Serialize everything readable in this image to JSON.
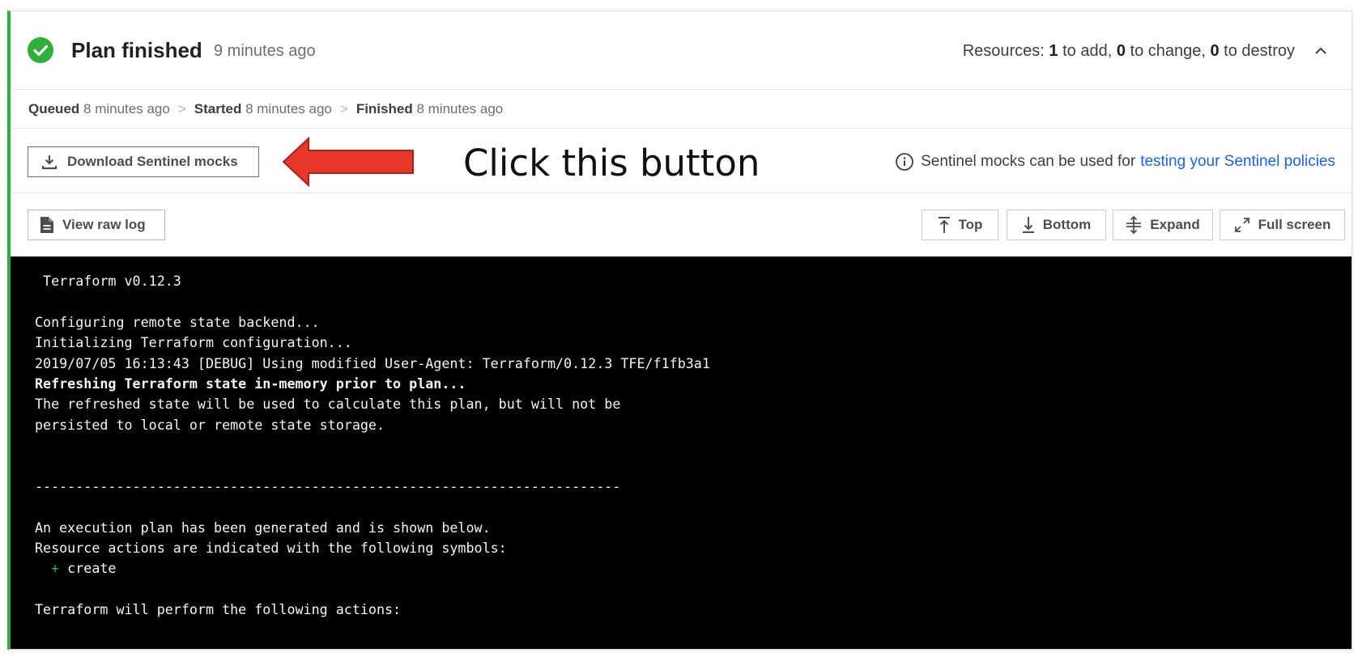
{
  "header": {
    "title": "Plan finished",
    "time_ago": "9 minutes ago",
    "resources_prefix": "Resources: ",
    "add_count": "1",
    "add_label": " to add, ",
    "change_count": "0",
    "change_label": " to change, ",
    "destroy_count": "0",
    "destroy_label": " to destroy"
  },
  "timeline": {
    "queued_label": "Queued",
    "queued_time": "8 minutes ago",
    "started_label": "Started",
    "started_time": "8 minutes ago",
    "finished_label": "Finished",
    "finished_time": "8 minutes ago",
    "separator": ">"
  },
  "sentinel": {
    "download_label": "Download Sentinel mocks",
    "annotation": "Click this button",
    "info_text": "Sentinel mocks can be used for",
    "info_link": "testing your Sentinel policies"
  },
  "toolbar": {
    "raw_log_label": "View raw log",
    "top_label": "Top",
    "bottom_label": "Bottom",
    "expand_label": "Expand",
    "fullscreen_label": "Full screen"
  },
  "log": {
    "line0": " Terraform v0.12.3",
    "line1": "",
    "line2": "Configuring remote state backend...",
    "line3": "Initializing Terraform configuration...",
    "line4": "2019/07/05 16:13:43 [DEBUG] Using modified User-Agent: Terraform/0.12.3 TFE/f1fb3a1",
    "line5": "Refreshing Terraform state in-memory prior to plan...",
    "line6": "The refreshed state will be used to calculate this plan, but will not be",
    "line7": "persisted to local or remote state storage.",
    "line8": "",
    "line9": "",
    "line10": "------------------------------------------------------------------------",
    "line11": "",
    "line12": "An execution plan has been generated and is shown below.",
    "line13": "Resource actions are indicated with the following symbols:",
    "line14_symbol": "+",
    "line14_text": " create",
    "line15": "",
    "line16": "Terraform will perform the following actions:"
  },
  "colors": {
    "success": "#2eb039",
    "link": "#1563ff",
    "annotation_arrow": "#e8372a",
    "terminal_bg": "#000000"
  }
}
